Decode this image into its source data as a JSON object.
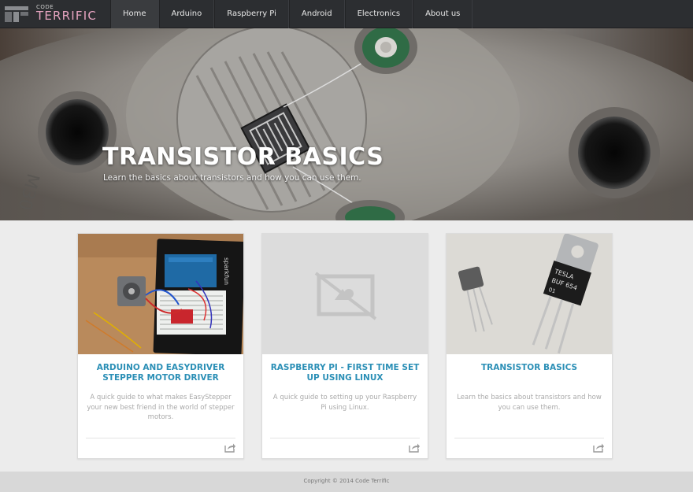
{
  "brand": {
    "small": "CODE",
    "name": "TERRIFIC",
    "accent": "#e6a4c0"
  },
  "nav": {
    "items": [
      {
        "label": "Home",
        "active": true
      },
      {
        "label": "Arduino"
      },
      {
        "label": "Raspberry Pi"
      },
      {
        "label": "Android"
      },
      {
        "label": "Electronics"
      },
      {
        "label": "About us"
      }
    ]
  },
  "hero": {
    "title": "TRANSISTOR BASICS",
    "subtitle": "Learn the basics about transistors and how you can use them.",
    "image_text": "M30"
  },
  "cards": [
    {
      "title": "ARDUINO AND EASYDRIVER STEPPER MOTOR DRIVER",
      "description": "A quick guide to what makes EasyStepper your new best friend in the world of stepper motors.",
      "image": "arduino-stepper-photo",
      "board_text": "sparkfun"
    },
    {
      "title": "RASPBERRY PI - FIRST TIME SET UP USING LINUX",
      "description": "A quick guide to setting up your Raspberry Pi using Linux.",
      "image": "no-image-placeholder-icon"
    },
    {
      "title": "TRANSISTOR BASICS",
      "description": "Learn the basics about transistors and how you can use them.",
      "image": "transistors-photo",
      "component_text": [
        "TESLA",
        "BUF 654",
        "01"
      ]
    }
  ],
  "share_icon": "share-icon",
  "colors": {
    "link": "#2b8fb6",
    "navbar": "#2c2e31",
    "footer": "#d8d8d8"
  },
  "footer": {
    "copyright": "Copyright © 2014 Code Terrific"
  }
}
